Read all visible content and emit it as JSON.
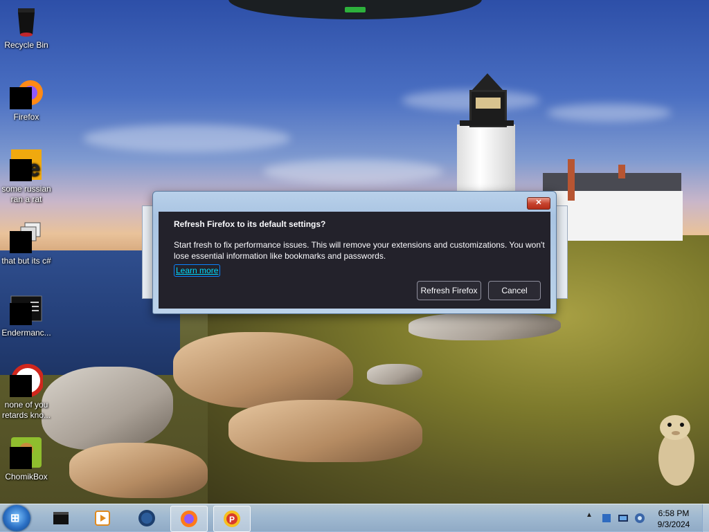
{
  "desktop": {
    "icons": [
      {
        "label": "Recycle Bin"
      },
      {
        "label": "Firefox"
      },
      {
        "label": "some russian ran a rat"
      },
      {
        "label": "that but its c#"
      },
      {
        "label": "Endermanc..."
      },
      {
        "label": "none of you retards kno..."
      },
      {
        "label": "ChomikBox"
      }
    ]
  },
  "dialog": {
    "close_glyph": "✕",
    "title": "Refresh Firefox to its default settings?",
    "body": "Start fresh to fix performance issues. This will remove your extensions and customizations. You won't lose essential information like bookmarks and passwords.",
    "learn_more": "Learn more",
    "refresh_label": "Refresh Firefox",
    "cancel_label": "Cancel"
  },
  "taskbar": {
    "start_glyph": "⊞",
    "items": [
      "terminal-icon",
      "media-player-icon",
      "globe-icon",
      "firefox-icon",
      "paint-icon"
    ],
    "active_item": "firefox-icon",
    "tray_arrow": "▲",
    "clock_time": "6:58 PM",
    "clock_date": "9/3/2024"
  },
  "colors": {
    "dialog_bg": "#23222b",
    "link": "#00ddff",
    "close_red": "#c7452f"
  }
}
